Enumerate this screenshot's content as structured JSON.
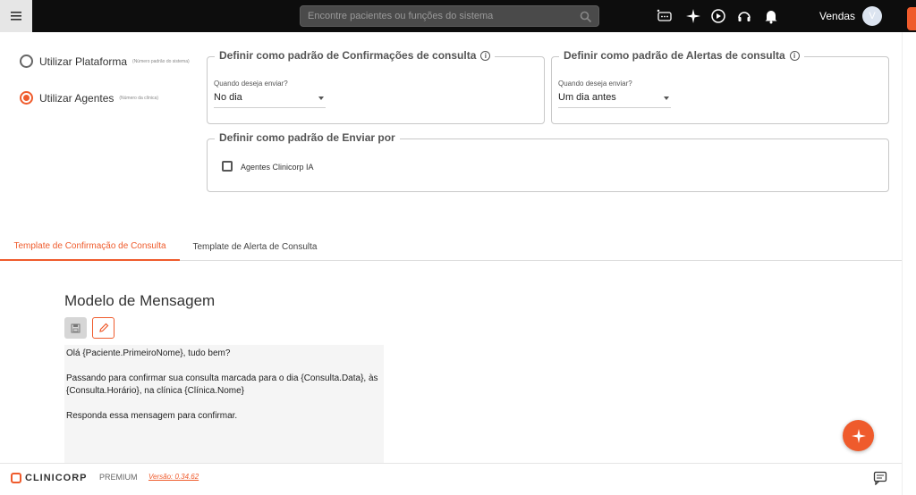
{
  "topbar": {
    "search_placeholder": "Encontre pacientes ou funções do sistema",
    "user_name": "Vendas",
    "avatar_initial": "V"
  },
  "options": {
    "platform": {
      "label": "Utilizar Plataforma",
      "note": "(Número padrão do sistema)",
      "selected": false
    },
    "agents": {
      "label": "Utilizar Agentes",
      "note": "(Número da clínica)",
      "selected": true
    }
  },
  "confirmations": {
    "legend": "Definir como padrão de Confirmações de consulta",
    "field_label": "Quando deseja enviar?",
    "value": "No dia"
  },
  "alerts": {
    "legend": "Definir como padrão de Alertas de consulta",
    "field_label": "Quando deseja enviar?",
    "value": "Um dia antes"
  },
  "send_by": {
    "legend": "Definir como padrão de Enviar por",
    "option_label": "Agentes Clinicorp IA",
    "checked": false
  },
  "tabs": [
    {
      "label": "Template de Confirmação de Consulta",
      "active": true
    },
    {
      "label": "Template de Alerta de Consulta",
      "active": false
    }
  ],
  "template": {
    "title": "Modelo de Mensagem",
    "message": "Olá {Paciente.PrimeiroNome}, tudo bem?\n\nPassando para confirmar sua consulta marcada para o dia {Consulta.Data}, às {Consulta.Horário}, na clínica {Clínica.Nome}\n\nResponda essa mensagem para confirmar."
  },
  "footer": {
    "brand": "CLINICORP",
    "plan": "PREMIUM",
    "version": "Versão: 0.34.62"
  },
  "colors": {
    "accent": "#ef5b2c",
    "topbar": "#0d0d0d"
  }
}
